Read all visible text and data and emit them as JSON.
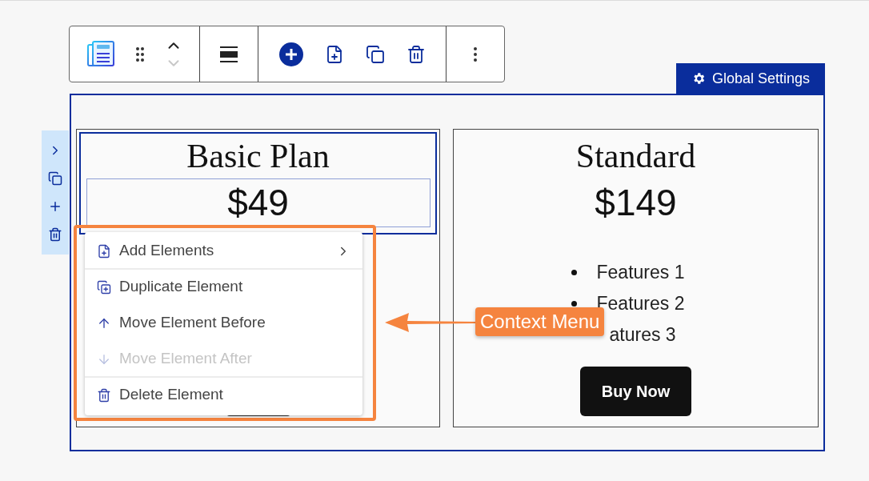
{
  "toolbar": {
    "move_up_disabled": false,
    "move_down_disabled": true
  },
  "global_settings": {
    "label": "Global Settings"
  },
  "cards": [
    {
      "title": "Basic Plan",
      "price": "$49",
      "selected": true
    },
    {
      "title": "Standard",
      "price": "$149",
      "selected": false,
      "features": [
        {
          "text": "Features 1",
          "bullet": true
        },
        {
          "text": "Features 2",
          "bullet": true
        },
        {
          "text": "atures 3",
          "bullet": false
        }
      ],
      "button": "Buy Now"
    }
  ],
  "context_menu": {
    "items": [
      {
        "label": "Add Elements",
        "submenu": true,
        "disabled": false,
        "divider_after": true
      },
      {
        "label": "Duplicate Element",
        "submenu": false,
        "disabled": false,
        "divider_after": false
      },
      {
        "label": "Move Element Before",
        "submenu": false,
        "disabled": false,
        "divider_after": false
      },
      {
        "label": "Move Element After",
        "submenu": false,
        "disabled": true,
        "divider_after": true
      },
      {
        "label": "Delete Element",
        "submenu": false,
        "disabled": false,
        "divider_after": false
      }
    ]
  },
  "callout": {
    "label": "Context Menu"
  }
}
